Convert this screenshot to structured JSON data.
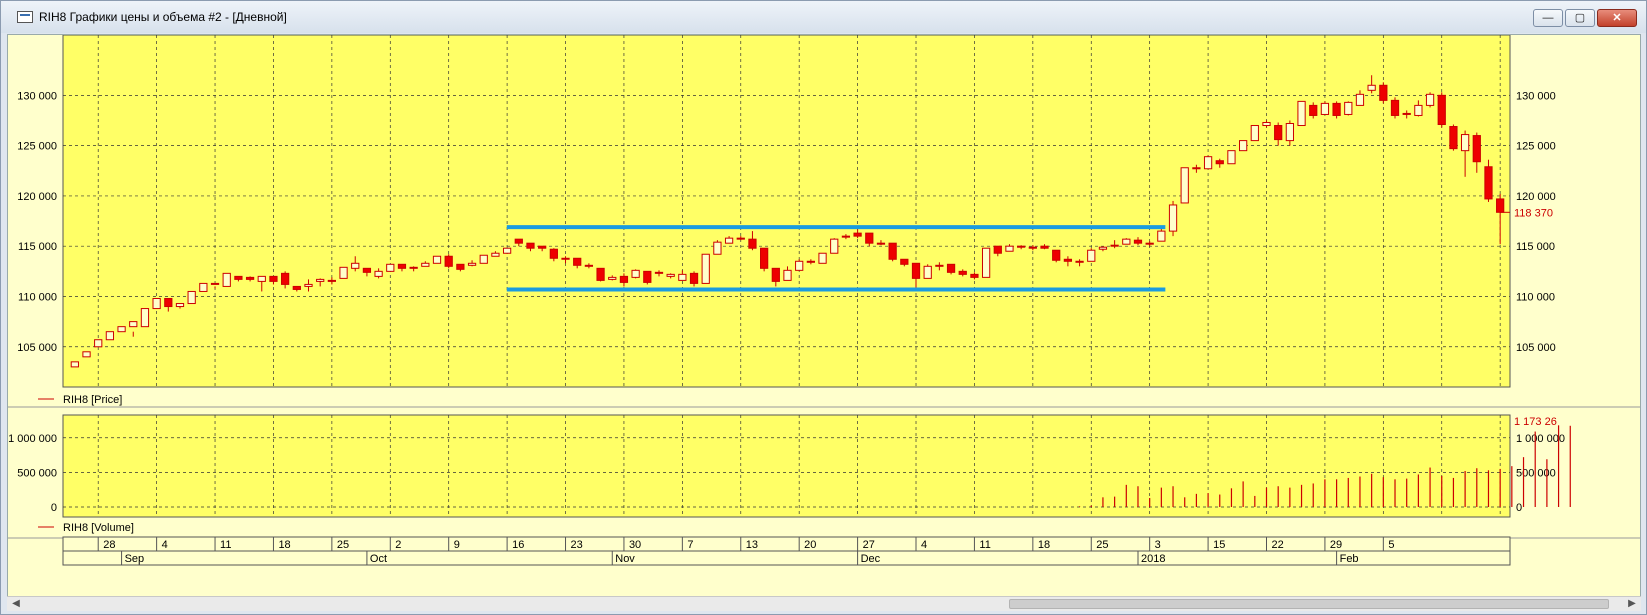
{
  "window": {
    "title": "RIH8 Графики цены и объема #2 - [Дневной]",
    "buttons": {
      "minimize": "—",
      "maximize": "▢",
      "close": "✕"
    }
  },
  "price_panel": {
    "legend": "RIH8 [Price]",
    "y_labels": [
      "130 000",
      "125 000",
      "120 000",
      "115 000",
      "110 000",
      "105 000"
    ],
    "last_value": "118 370",
    "up_color": "#ffffcc",
    "down_color": "#ee0000",
    "band_color": "#1a9be0"
  },
  "volume_panel": {
    "legend": "RIH8 [Volume]",
    "y_labels_left": [
      "1 000 000",
      "500 000",
      "0"
    ],
    "y_labels_right": [
      "1 000 000",
      "500 000",
      "0"
    ],
    "last_value": "1 173 26"
  },
  "time_axis": {
    "days": [
      "28",
      "4",
      "11",
      "18",
      "25",
      "2",
      "9",
      "16",
      "23",
      "30",
      "7",
      "13",
      "20",
      "27",
      "4",
      "11",
      "18",
      "25",
      "3",
      "15",
      "22",
      "29",
      "5"
    ],
    "months": [
      "Sep",
      "Oct",
      "Nov",
      "Dec",
      "2018",
      "Feb"
    ]
  },
  "scrollbar": {
    "left_arrow": "◀",
    "right_arrow": "▶"
  },
  "chart_data": {
    "type": "candlestick",
    "price_ylim": [
      101000,
      136000
    ],
    "volume_ylim": [
      0,
      1300000
    ],
    "grid": true,
    "candles": [
      [
        103000,
        103500,
        103000,
        103500
      ],
      [
        104000,
        104500,
        104000,
        104500
      ],
      [
        105000,
        105700,
        105000,
        105700
      ],
      [
        105700,
        106500,
        105700,
        106500
      ],
      [
        106500,
        107000,
        106500,
        107000
      ],
      [
        107000,
        107500,
        106000,
        106500
      ],
      [
        107000,
        108800,
        107000,
        108800
      ],
      [
        108800,
        109800,
        108800,
        109800
      ],
      [
        109800,
        109000,
        108500,
        109500
      ],
      [
        109000,
        109300,
        108800,
        109300
      ],
      [
        109300,
        110500,
        109300,
        110500
      ],
      [
        110500,
        111300,
        110500,
        111300
      ],
      [
        111300,
        111200,
        110800,
        111000
      ],
      [
        111000,
        112300,
        111000,
        112300
      ],
      [
        112000,
        111700,
        111500,
        112000
      ],
      [
        111900,
        111700,
        111500,
        112000
      ],
      [
        111500,
        112000,
        110500,
        112000
      ],
      [
        112000,
        111500,
        111200,
        111700
      ],
      [
        112300,
        111200,
        110800,
        112500
      ],
      [
        111000,
        110700,
        110500,
        111000
      ],
      [
        111000,
        111200,
        110500,
        111700
      ],
      [
        111500,
        111700,
        111000,
        111800
      ],
      [
        111500,
        111600,
        111200,
        111900
      ],
      [
        111800,
        112900,
        111800,
        112900
      ],
      [
        112800,
        113300,
        112500,
        114000
      ],
      [
        112800,
        112400,
        112000,
        112800
      ],
      [
        112000,
        112500,
        111800,
        112800
      ],
      [
        112500,
        113200,
        112500,
        113200
      ],
      [
        113200,
        112800,
        112500,
        113200
      ],
      [
        112800,
        112900,
        112500,
        113000
      ],
      [
        113000,
        113300,
        113000,
        113500
      ],
      [
        113300,
        114000,
        113300,
        114000
      ],
      [
        114000,
        113000,
        112800,
        114200
      ],
      [
        113200,
        112700,
        112500,
        113200
      ],
      [
        113100,
        113300,
        113000,
        113600
      ],
      [
        113300,
        114100,
        113300,
        114100
      ],
      [
        114000,
        114300,
        114000,
        114500
      ],
      [
        114300,
        114800,
        114300,
        114800
      ],
      [
        115700,
        115300,
        115000,
        115700
      ],
      [
        115300,
        114800,
        114500,
        115300
      ],
      [
        115000,
        114800,
        114500,
        115000
      ],
      [
        114700,
        113800,
        113500,
        114800
      ],
      [
        113800,
        113700,
        113300,
        114000
      ],
      [
        113800,
        113100,
        112800,
        113800
      ],
      [
        113100,
        113000,
        112800,
        113300
      ],
      [
        112800,
        111600,
        111500,
        112800
      ],
      [
        111700,
        111900,
        111600,
        112100
      ],
      [
        112000,
        111400,
        111000,
        112300
      ],
      [
        111900,
        112600,
        111800,
        112700
      ],
      [
        112500,
        111400,
        111200,
        112500
      ],
      [
        112300,
        112400,
        112000,
        112600
      ],
      [
        112000,
        112200,
        111800,
        112300
      ],
      [
        111600,
        112200,
        111600,
        112600
      ],
      [
        112300,
        111300,
        111000,
        112500
      ],
      [
        111300,
        114200,
        111300,
        114200
      ],
      [
        114200,
        115400,
        114200,
        115600
      ],
      [
        115300,
        115800,
        115300,
        116000
      ],
      [
        115800,
        115800,
        115600,
        116000
      ],
      [
        115700,
        114800,
        114600,
        116500
      ],
      [
        114800,
        112800,
        112500,
        114800
      ],
      [
        112800,
        111500,
        111000,
        112800
      ],
      [
        111600,
        112600,
        111600,
        113000
      ],
      [
        112600,
        113500,
        112600,
        113700
      ],
      [
        113500,
        113400,
        113200,
        113700
      ],
      [
        113300,
        114300,
        113300,
        114300
      ],
      [
        114300,
        115700,
        114300,
        115800
      ],
      [
        116000,
        116000,
        115700,
        116200
      ],
      [
        116300,
        116000,
        115800,
        116700
      ],
      [
        116300,
        115300,
        115000,
        116300
      ],
      [
        115300,
        115300,
        115100,
        115600
      ],
      [
        115300,
        113700,
        113500,
        115300
      ],
      [
        113700,
        113200,
        113000,
        113700
      ],
      [
        113300,
        111800,
        110800,
        113300
      ],
      [
        111800,
        113000,
        111800,
        113200
      ],
      [
        113000,
        113100,
        112600,
        113400
      ],
      [
        113200,
        112400,
        112200,
        113200
      ],
      [
        112500,
        112200,
        112000,
        112700
      ],
      [
        112200,
        111900,
        111700,
        112400
      ],
      [
        111900,
        114800,
        111900,
        114800
      ],
      [
        115000,
        114300,
        114000,
        115000
      ],
      [
        114500,
        115000,
        114500,
        115200
      ],
      [
        114900,
        115000,
        114700,
        115100
      ],
      [
        114900,
        114800,
        114600,
        115100
      ],
      [
        115000,
        114800,
        114700,
        115200
      ],
      [
        114600,
        113600,
        113400,
        114600
      ],
      [
        113700,
        113500,
        113000,
        114000
      ],
      [
        113500,
        113500,
        113000,
        113700
      ],
      [
        113500,
        114600,
        113500,
        114800
      ],
      [
        114700,
        114900,
        114500,
        115000
      ],
      [
        115000,
        115100,
        114800,
        115600
      ],
      [
        115200,
        115700,
        115200,
        115800
      ],
      [
        115600,
        115300,
        115100,
        115900
      ],
      [
        115300,
        115200,
        115000,
        115500
      ],
      [
        115500,
        116500,
        115500,
        116800
      ],
      [
        116500,
        119100,
        116000,
        119500
      ],
      [
        119300,
        122800,
        119300,
        122800
      ],
      [
        122700,
        122800,
        122300,
        123100
      ],
      [
        122700,
        123900,
        122700,
        124000
      ],
      [
        123500,
        123200,
        122800,
        123700
      ],
      [
        123200,
        124500,
        123200,
        124500
      ],
      [
        124500,
        125500,
        124500,
        125500
      ],
      [
        125500,
        127000,
        125500,
        127000
      ],
      [
        127000,
        127300,
        126800,
        127500
      ],
      [
        127000,
        125600,
        125000,
        127300
      ],
      [
        125500,
        127200,
        125000,
        127500
      ],
      [
        127000,
        129400,
        127000,
        129400
      ],
      [
        129000,
        128000,
        127700,
        129300
      ],
      [
        128100,
        129200,
        128100,
        129400
      ],
      [
        129200,
        128000,
        127700,
        129400
      ],
      [
        128100,
        129300,
        128000,
        129400
      ],
      [
        129000,
        130100,
        129000,
        130500
      ],
      [
        130500,
        131000,
        130200,
        132000
      ],
      [
        131000,
        129500,
        129200,
        131300
      ],
      [
        129500,
        128000,
        127700,
        129800
      ],
      [
        128200,
        128200,
        127700,
        128500
      ],
      [
        128000,
        129000,
        127900,
        129500
      ],
      [
        129000,
        130100,
        128800,
        130300
      ],
      [
        130000,
        127100,
        126800,
        130300
      ],
      [
        126900,
        124700,
        124500,
        127100
      ],
      [
        124500,
        126100,
        121900,
        126500
      ],
      [
        126000,
        123400,
        122300,
        126300
      ],
      [
        122900,
        119700,
        119400,
        123600
      ],
      [
        119700,
        118370,
        115200,
        120200
      ]
    ],
    "volumes": [
      0,
      0,
      0,
      0,
      0,
      0,
      0,
      0,
      0,
      0,
      0,
      0,
      0,
      0,
      0,
      0,
      0,
      0,
      0,
      0,
      0,
      0,
      0,
      0,
      0,
      0,
      0,
      0,
      0,
      0,
      0,
      0,
      0,
      0,
      0,
      0,
      0,
      0,
      0,
      0,
      0,
      0,
      0,
      0,
      0,
      0,
      0,
      0,
      0,
      0,
      0,
      0,
      0,
      0,
      0,
      0,
      0,
      0,
      0,
      0,
      0,
      0,
      0,
      0,
      0,
      0,
      0,
      0,
      0,
      0,
      0,
      0,
      0,
      0,
      0,
      0,
      0,
      0,
      0,
      0,
      0,
      0,
      0,
      0,
      0,
      0,
      10000,
      20000,
      140000,
      150000,
      320000,
      300000,
      130000,
      280000,
      300000,
      140000,
      190000,
      200000,
      180000,
      270000,
      370000,
      160000,
      280000,
      300000,
      280000,
      320000,
      340000,
      400000,
      400000,
      420000,
      440000,
      480000,
      430000,
      400000,
      410000,
      470000,
      570000,
      450000,
      420000,
      520000,
      560000,
      530000,
      550000,
      590000,
      720000,
      1090000,
      690000,
      1180000,
      1173260
    ],
    "bands": [
      {
        "price": 116900,
        "from_index": 38,
        "to_index": 93
      },
      {
        "price": 110700,
        "from_index": 38,
        "to_index": 93
      }
    ],
    "y_ticks": [
      105000,
      110000,
      115000,
      120000,
      125000,
      130000
    ],
    "volume_ticks": [
      0,
      500000,
      1000000
    ]
  }
}
